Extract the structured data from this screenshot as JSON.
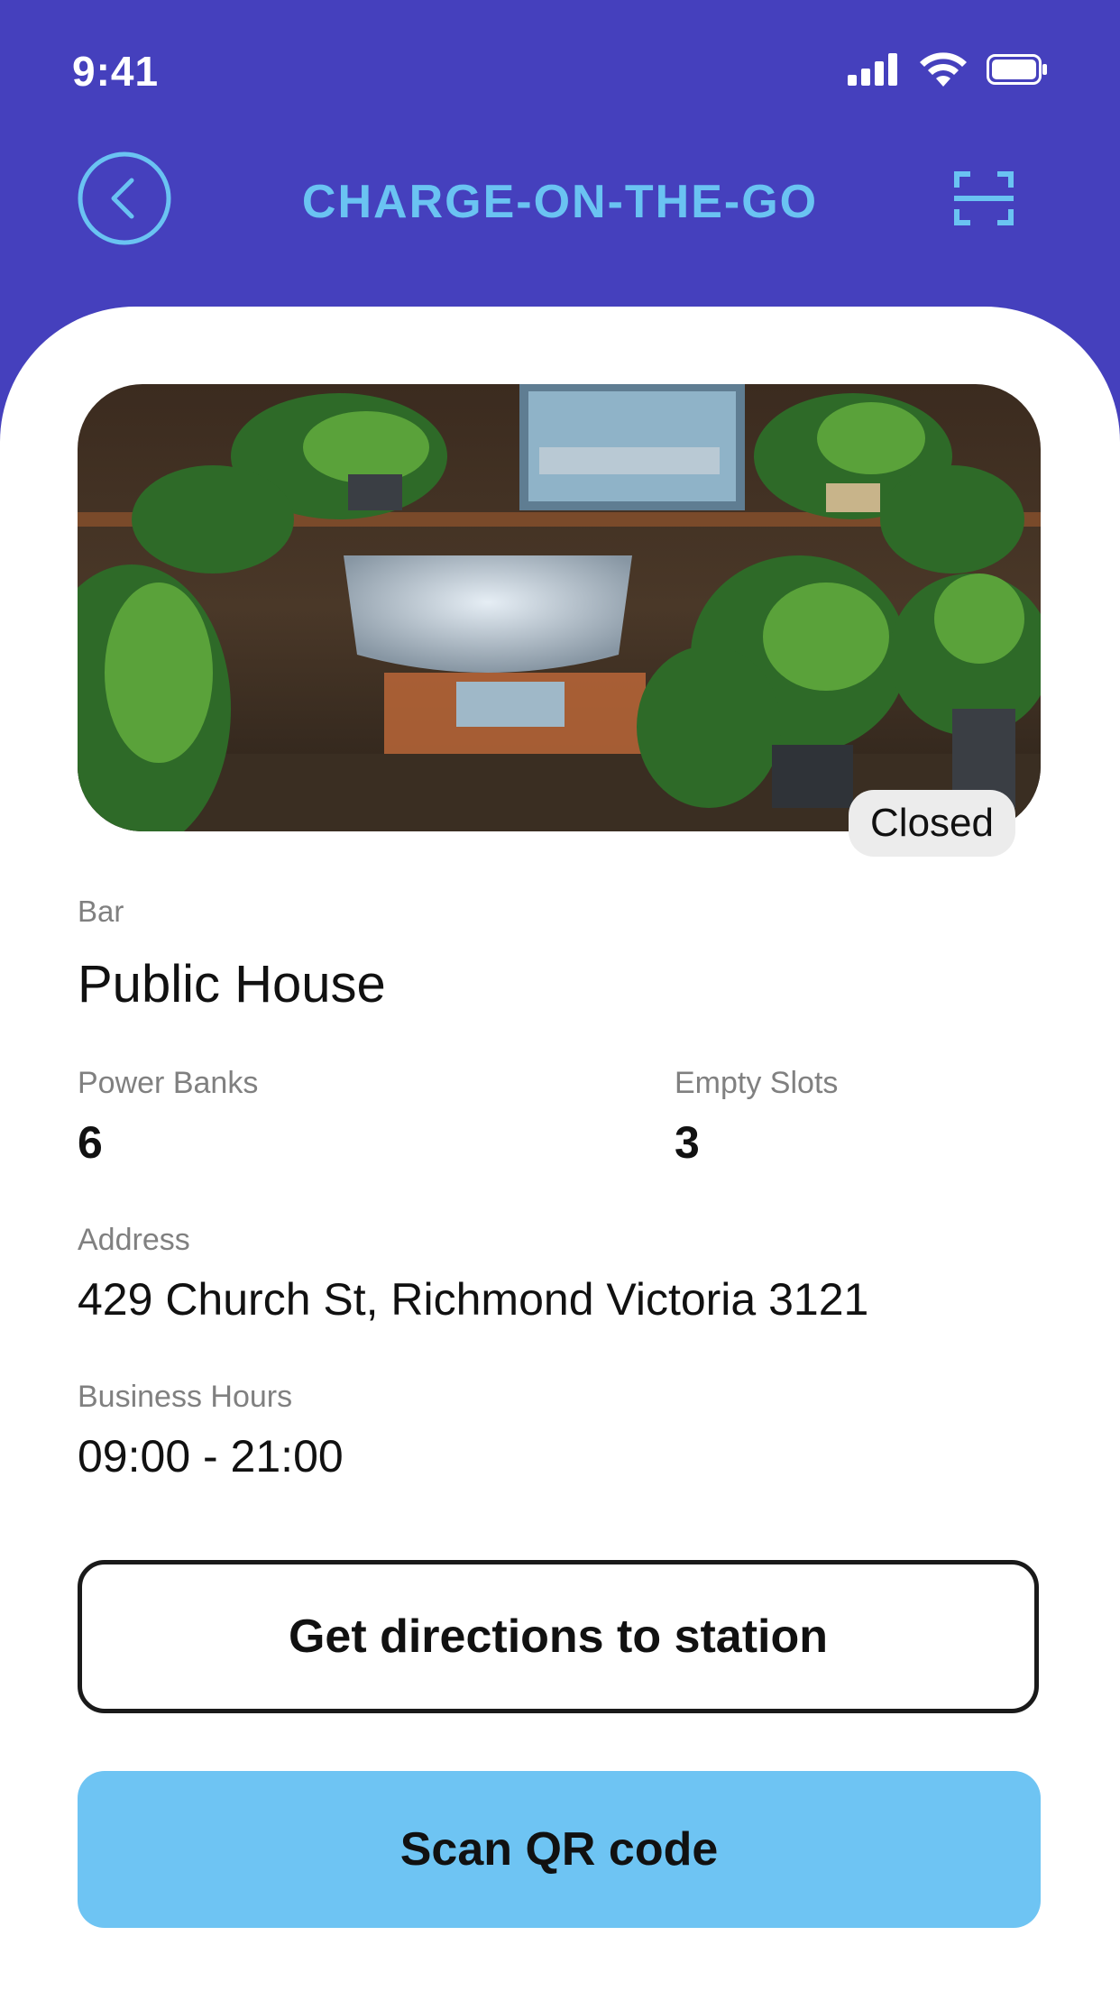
{
  "status_bar": {
    "time": "9:41"
  },
  "header": {
    "title": "CHARGE-ON-THE-GO",
    "back_icon": "chevron-left-icon",
    "scan_icon": "scan-frame-icon"
  },
  "venue": {
    "status": "Closed",
    "category": "Bar",
    "name": "Public House",
    "power_banks_label": "Power Banks",
    "power_banks_value": "6",
    "empty_slots_label": "Empty Slots",
    "empty_slots_value": "3",
    "address_label": "Address",
    "address_value": "429 Church St, Richmond Victoria 3121",
    "hours_label": "Business Hours",
    "hours_value": "09:00 - 21:00"
  },
  "actions": {
    "directions_label": "Get directions to station",
    "scan_label": "Scan QR code"
  },
  "colors": {
    "header_bg": "#4540bd",
    "accent_light_blue": "#6ec4f3",
    "text_dark": "#111111"
  }
}
